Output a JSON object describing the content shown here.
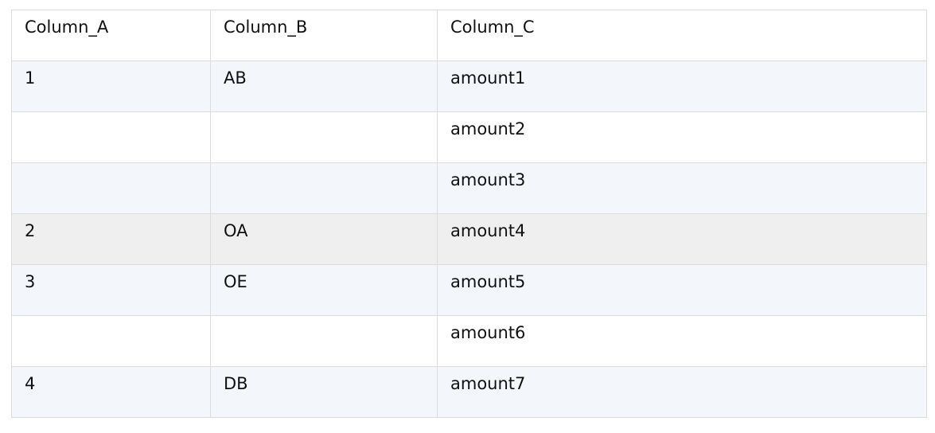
{
  "table": {
    "headers": [
      "Column_A",
      "Column_B",
      "Column_C"
    ],
    "rows": [
      {
        "cells": [
          "1",
          "AB",
          "amount1"
        ],
        "background": "#f3f6fa"
      },
      {
        "cells": [
          "",
          "",
          "amount2"
        ],
        "background": "#ffffff"
      },
      {
        "cells": [
          "",
          "",
          "amount3"
        ],
        "background": "#f3f6fa"
      },
      {
        "cells": [
          "2",
          "OA",
          "amount4"
        ],
        "background": "#efefef"
      },
      {
        "cells": [
          "3",
          "OE",
          "amount5"
        ],
        "background": "#f3f6fa"
      },
      {
        "cells": [
          "",
          "",
          "amount6"
        ],
        "background": "#ffffff"
      },
      {
        "cells": [
          "4",
          "DB",
          "amount7"
        ],
        "background": "#f3f6fa"
      }
    ]
  }
}
